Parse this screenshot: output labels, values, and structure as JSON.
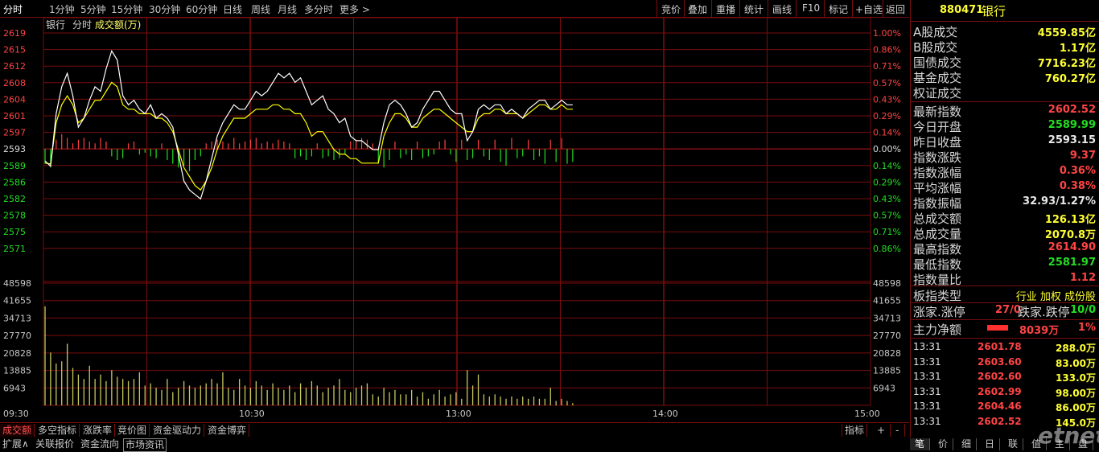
{
  "toolbar": {
    "periods": [
      "分时",
      "1分钟",
      "5分钟",
      "15分钟",
      "30分钟",
      "60分钟",
      "日线",
      "周线",
      "月线",
      "多分时",
      "更多 >"
    ],
    "tools": [
      "竞价",
      "叠加",
      "重播",
      "统计",
      "画线",
      "F10",
      "标记",
      "+自选",
      "返回"
    ]
  },
  "chart": {
    "caption_name": "银行",
    "caption_mode": "分时",
    "caption_vol": "成交额(万)",
    "price_ticks": [
      "2619",
      "2615",
      "2612",
      "2608",
      "2604",
      "2601",
      "2597",
      "2593",
      "2589",
      "2586",
      "2582",
      "2578",
      "2575",
      "2571"
    ],
    "pct_ticks": [
      "1.00%",
      "0.86%",
      "0.71%",
      "0.57%",
      "0.43%",
      "0.29%",
      "0.14%",
      "0.00%",
      "0.14%",
      "0.29%",
      "0.43%",
      "0.57%",
      "0.71%",
      "0.86%"
    ],
    "vol_ticks": [
      "48598",
      "41655",
      "34713",
      "27770",
      "20828",
      "13885",
      "6943"
    ],
    "time_labels": [
      "09:30",
      "10:30",
      "13:00",
      "14:00",
      "15:00"
    ],
    "prev_close": 2593.15,
    "price_max": 2619,
    "price_min": 2567.3,
    "vol_max": 55540,
    "price_line": [
      2590.5,
      2589.3,
      2601,
      2607,
      2610,
      2605,
      2598,
      2600,
      2604,
      2607,
      2606,
      2611,
      2615,
      2613,
      2605,
      2603,
      2604,
      2602,
      2601,
      2603,
      2600,
      2601,
      2600,
      2598,
      2592,
      2586,
      2584,
      2583,
      2582,
      2586,
      2591,
      2596,
      2599,
      2601,
      2603,
      2602,
      2602,
      2604,
      2606,
      2605,
      2606,
      2608,
      2610,
      2609,
      2610,
      2608,
      2609,
      2606,
      2603,
      2604,
      2605,
      2602,
      2601,
      2599,
      2600,
      2596,
      2595,
      2595,
      2594,
      2593,
      2593,
      2599,
      2603,
      2604,
      2603,
      2601,
      2598,
      2599,
      2602,
      2604,
      2606,
      2606,
      2604,
      2602,
      2601,
      2601,
      2595,
      2597,
      2602,
      2603,
      2602,
      2603,
      2603,
      2601,
      2602,
      2601,
      2600,
      2602,
      2603,
      2604,
      2604,
      2602,
      2603,
      2604,
      2603,
      2603
    ],
    "avg_line": [
      2590,
      2589.8,
      2599,
      2603,
      2605,
      2603,
      2599,
      2600,
      2602,
      2604,
      2604,
      2606,
      2608,
      2607,
      2603,
      2602,
      2602,
      2601,
      2601,
      2601,
      2600,
      2600,
      2599,
      2597,
      2593,
      2589,
      2587,
      2585,
      2584,
      2586,
      2589,
      2593,
      2596,
      2598,
      2600,
      2600,
      2600,
      2601,
      2602,
      2602,
      2602,
      2603,
      2603,
      2602,
      2602,
      2601,
      2601,
      2599,
      2596,
      2597,
      2597,
      2595,
      2593,
      2592,
      2592,
      2591,
      2591,
      2590,
      2590,
      2590,
      2590,
      2596,
      2599,
      2601,
      2601,
      2600,
      2598,
      2598,
      2600,
      2601,
      2602,
      2602,
      2601,
      2600,
      2599,
      2598,
      2597,
      2597,
      2600,
      2601,
      2601,
      2602,
      2602,
      2601,
      2601,
      2601,
      2600,
      2601,
      2602,
      2603,
      2603,
      2602,
      2602,
      2603,
      2602,
      2602
    ],
    "vols": [
      45000,
      24000,
      19000,
      20000,
      28000,
      17000,
      14000,
      12000,
      18000,
      12000,
      14000,
      11000,
      16000,
      13000,
      12000,
      11000,
      12000,
      15000,
      9000,
      10000,
      8000,
      7000,
      12000,
      6000,
      8000,
      11000,
      9000,
      8000,
      9000,
      10000,
      12000,
      10000,
      15000,
      8000,
      7000,
      12000,
      9000,
      8000,
      11000,
      9000,
      7000,
      10000,
      8000,
      7000,
      9000,
      6000,
      10000,
      8000,
      11000,
      9000,
      6000,
      8000,
      9000,
      12000,
      7000,
      6000,
      8000,
      9000,
      10000,
      5000,
      4000,
      8000,
      6000,
      7000,
      5000,
      5000,
      7000,
      4000,
      6000,
      3000,
      5000,
      7000,
      4000,
      5000,
      6000,
      3000,
      16000,
      9000,
      14000,
      5000,
      4000,
      5000,
      4000,
      3000,
      4000,
      3000,
      4000,
      3000,
      4000,
      3000,
      3000,
      8000,
      2000,
      3000,
      2000,
      1000
    ],
    "bars": [
      -8,
      -10,
      5,
      8,
      6,
      3,
      5,
      6,
      4,
      3,
      6,
      4,
      -4,
      -6,
      -5,
      3,
      4,
      -3,
      -2,
      -4,
      -5,
      3,
      -6,
      -8,
      -10,
      -9,
      -12,
      -6,
      -4,
      3,
      4,
      5,
      4,
      3,
      6,
      3,
      4,
      5,
      6,
      3,
      4,
      3,
      5,
      4,
      3,
      -5,
      -4,
      -6,
      -4,
      3,
      -5,
      -4,
      -6,
      -5,
      -3,
      4,
      5,
      6,
      5,
      3,
      -8,
      -10,
      -6,
      4,
      -5,
      -3,
      -6,
      4,
      -5,
      -4,
      -3,
      4,
      5,
      -3,
      -7,
      5,
      -6,
      -5,
      5,
      -4,
      -6,
      5,
      -7,
      -9,
      6,
      -5,
      -4,
      5,
      -6,
      -4,
      -8,
      5,
      -7,
      6,
      -8,
      -7
    ]
  },
  "bottom_tabs": [
    "成交额",
    "多空指标",
    "涨跌率",
    "竞价图",
    "资金驱动力",
    "资金博弈"
  ],
  "bottom_right": [
    "指标",
    "+",
    "-"
  ],
  "bottom_bar": [
    "扩展∧",
    "关联报价",
    "资金流向",
    "市场资讯"
  ],
  "right": {
    "code": "880471",
    "name": "银行",
    "volumes": [
      {
        "label": "A股成交",
        "value": "4559.85亿"
      },
      {
        "label": "B股成交",
        "value": "1.17亿"
      },
      {
        "label": "国债成交",
        "value": "7716.23亿"
      },
      {
        "label": "基金成交",
        "value": "760.27亿"
      },
      {
        "label": "权证成交",
        "value": ""
      }
    ],
    "stats": [
      {
        "label": "最新指数",
        "value": "2602.52",
        "color": "red"
      },
      {
        "label": "今日开盘",
        "value": "2589.99",
        "color": "green"
      },
      {
        "label": "昨日收盘",
        "value": "2593.15",
        "color": "white"
      },
      {
        "label": "指数涨跌",
        "value": "9.37",
        "color": "red"
      },
      {
        "label": "指数涨幅",
        "value": "0.36%",
        "color": "red"
      },
      {
        "label": "平均涨幅",
        "value": "0.38%",
        "color": "red"
      },
      {
        "label": "指数振幅",
        "value": "32.93/1.27%",
        "color": "white"
      },
      {
        "label": "总成交额",
        "value": "126.13亿",
        "color": "yellow"
      },
      {
        "label": "总成交量",
        "value": "2070.8万",
        "color": "yellow"
      },
      {
        "label": "最高指数",
        "value": "2614.90",
        "color": "red"
      },
      {
        "label": "最低指数",
        "value": "2581.97",
        "color": "green"
      },
      {
        "label": "指数量比",
        "value": "1.12",
        "color": "red"
      }
    ],
    "board_label": "板指类型",
    "board_value": "行业 加权 成份股",
    "updown_label1": "涨家.涨停",
    "updown_val1": "27/0",
    "updown_label2": "跌家.跌停",
    "updown_val2": "10/0",
    "main_label": "主力净额",
    "main_value": "8039万",
    "main_pct": "1%",
    "ticks": [
      {
        "time": "13:31",
        "price": "2601.78",
        "vol": "288.0万"
      },
      {
        "time": "13:31",
        "price": "2603.60",
        "vol": "83.00万"
      },
      {
        "time": "13:31",
        "price": "2602.60",
        "vol": "133.0万"
      },
      {
        "time": "13:31",
        "price": "2602.99",
        "vol": "98.00万"
      },
      {
        "time": "13:31",
        "price": "2604.46",
        "vol": "86.00万"
      },
      {
        "time": "13:31",
        "price": "2602.52",
        "vol": "145.0万"
      }
    ],
    "tabs": [
      "笔",
      "价",
      "细",
      "日",
      "联",
      "值",
      "主",
      "盘"
    ],
    "watermark": "etnet"
  },
  "colors": {
    "grid": "#7a0d0d",
    "price_line": "#ffffff",
    "avg_line": "#ffff00",
    "up": "#ff4040",
    "down": "#22dd22",
    "vol_bar": "#c8c860"
  }
}
